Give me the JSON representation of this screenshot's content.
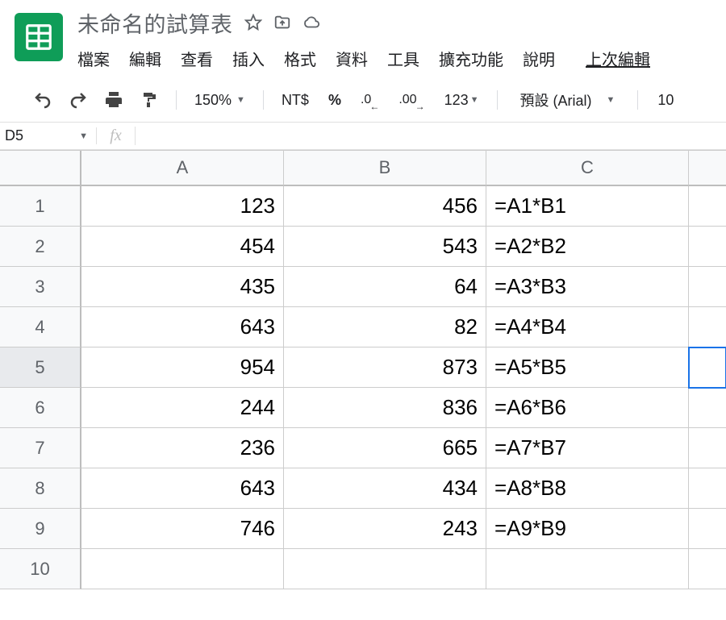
{
  "doc_title": "未命名的試算表",
  "menu": [
    "檔案",
    "編輯",
    "查看",
    "插入",
    "格式",
    "資料",
    "工具",
    "擴充功能",
    "說明"
  ],
  "last_edit_label": "上次編輯",
  "toolbar": {
    "zoom": "150%",
    "currency": "NT$",
    "percent": "%",
    "dec_dec": ".0",
    "dec_inc": ".00",
    "format_123": "123",
    "font_name": "預設 (Arial)",
    "font_size": "10"
  },
  "namebox": "D5",
  "fx_label": "fx",
  "fx_value": "",
  "columns": [
    "A",
    "B",
    "C"
  ],
  "rows": [
    {
      "n": "1",
      "a": "123",
      "b": "456",
      "c": "=A1*B1"
    },
    {
      "n": "2",
      "a": "454",
      "b": "543",
      "c": "=A2*B2"
    },
    {
      "n": "3",
      "a": "435",
      "b": "64",
      "c": "=A3*B3"
    },
    {
      "n": "4",
      "a": "643",
      "b": "82",
      "c": "=A4*B4"
    },
    {
      "n": "5",
      "a": "954",
      "b": "873",
      "c": "=A5*B5"
    },
    {
      "n": "6",
      "a": "244",
      "b": "836",
      "c": "=A6*B6"
    },
    {
      "n": "7",
      "a": "236",
      "b": "665",
      "c": "=A7*B7"
    },
    {
      "n": "8",
      "a": "643",
      "b": "434",
      "c": "=A8*B8"
    },
    {
      "n": "9",
      "a": "746",
      "b": "243",
      "c": "=A9*B9"
    },
    {
      "n": "10",
      "a": "",
      "b": "",
      "c": ""
    }
  ],
  "selected_row": 4
}
